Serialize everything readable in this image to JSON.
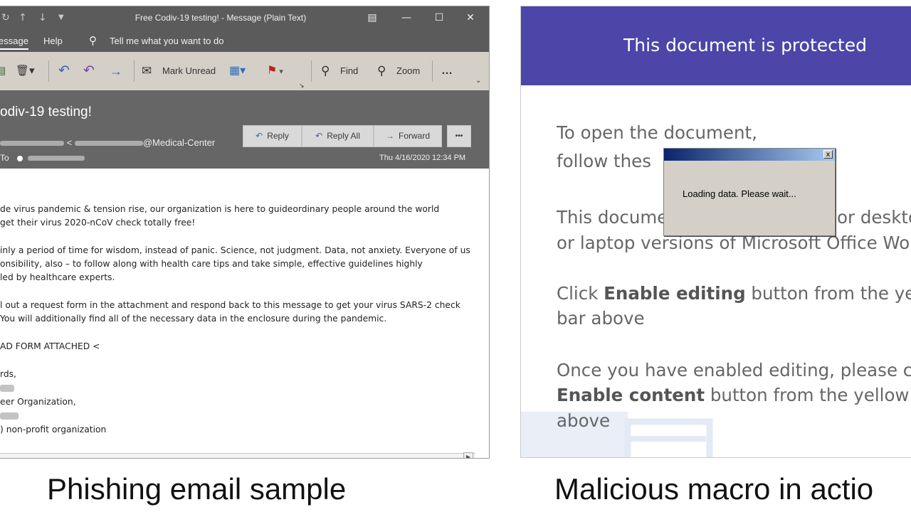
{
  "email": {
    "window_title": "Free Codiv-19 testing!  -  Message (Plain Text)",
    "tabs": {
      "message": "essage",
      "help": "Help",
      "tell_me": "Tell me what you want to do"
    },
    "ribbon": {
      "mark_unread": "Mark Unread",
      "find": "Find",
      "zoom": "Zoom",
      "more": "…"
    },
    "subject": "odiv-19 testing!",
    "sender_lt": "<",
    "sender_domain": "@Medical-Center",
    "to_label": "To",
    "datetime": "Thu 4/16/2020 12:34 PM",
    "actions": {
      "reply": "Reply",
      "reply_all": "Reply All",
      "forward": "Forward",
      "more": "•••"
    },
    "body_lines": [
      "de virus pandemic & tension rise, our organization is here to guideordinary people around the world",
      "get their  virus 2020-nCoV check totally free!",
      "inly a period of time for wisdom, instead of panic. Science, not judgment. Data, not anxiety. Everyone of us",
      "onsibility, also – to follow along with health care tips and take simple, effective guidelines highly",
      "led by healthcare experts.",
      "l out a request form in the attachment and respond back to this message to get your virus SARS-2 check",
      "You will additionally find all of the necessary data in the enclosure during the pandemic.",
      "AD FORM ATTACHED <",
      "rds,",
      "eer Organization,",
      ") non-profit organization"
    ]
  },
  "word": {
    "banner_title": "This document is protected",
    "open_line1": "To open the document,",
    "open_line2": "follow thes",
    "doc_line1_a": "This docume",
    "doc_line1_b": "or deskto",
    "doc_line2": "or laptop versions of Microsoft Office Wor",
    "click_pre": "Click ",
    "click_bold": "Enable editing",
    "click_post": " button from the yello",
    "bar_above": "bar above",
    "once_line": "Once you have enabled editing, please clic",
    "content_bold": "Enable content",
    "content_post": " button from the yellow ba",
    "above": "above"
  },
  "dialog": {
    "message": "Loading data. Please wait...",
    "close": "x"
  },
  "captions": {
    "left": "Phishing email sample",
    "right": "Malicious macro in actio"
  },
  "colors": {
    "banner": "#4b46a8",
    "ribbon": "#d4d0c8",
    "header": "#666666",
    "titlebar": "#5b5b5b"
  }
}
